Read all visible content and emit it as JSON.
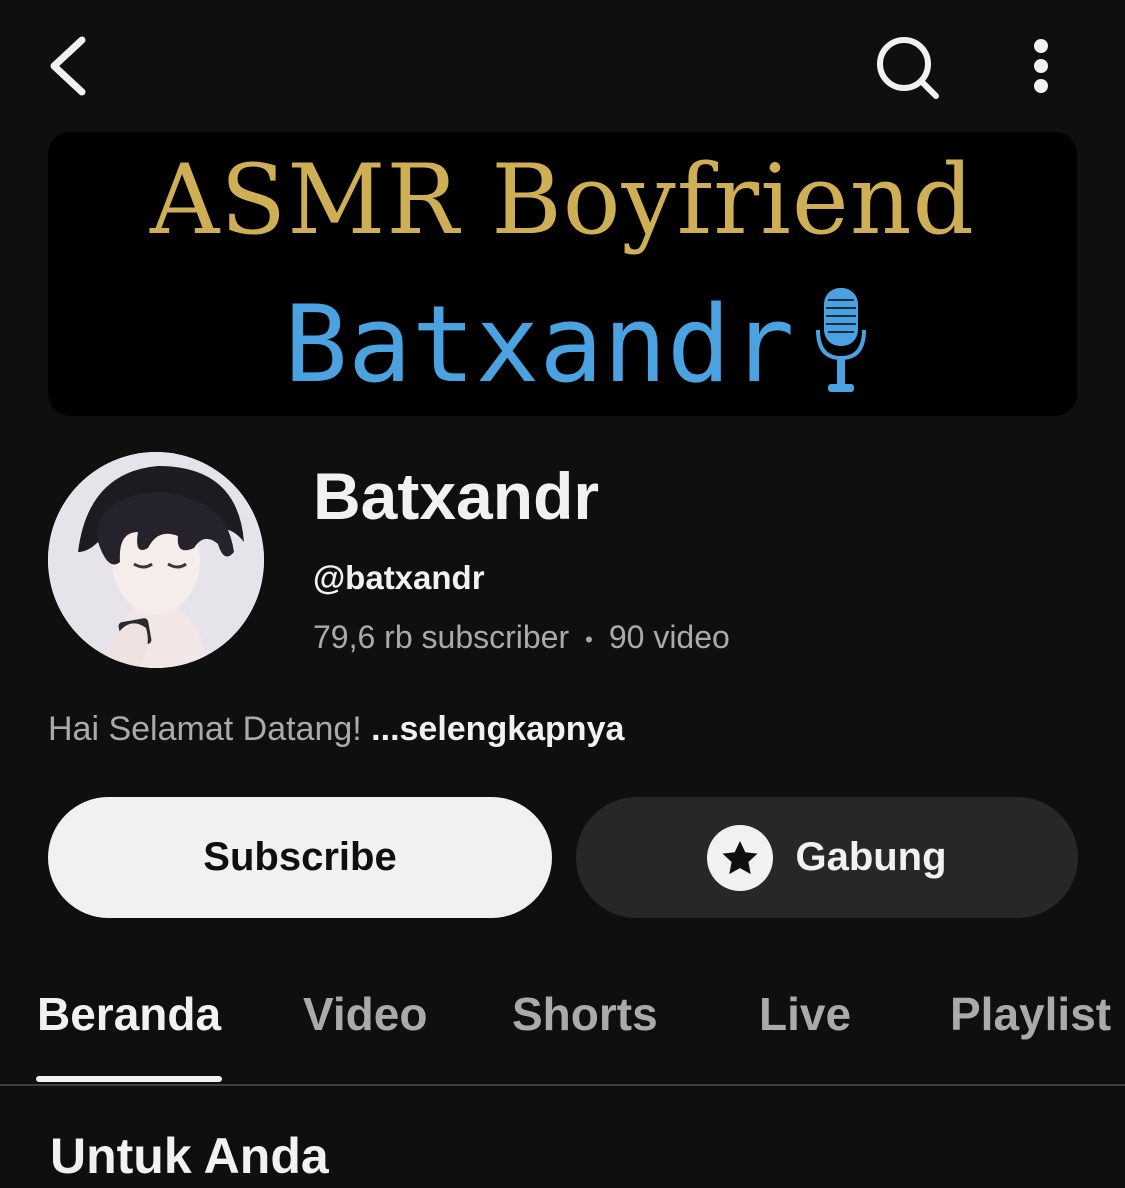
{
  "header": {
    "back_icon": "chevron-left-icon",
    "search_icon": "search-icon",
    "more_icon": "more-vertical-icon"
  },
  "banner": {
    "line1": "ASMR Boyfriend",
    "line2": "Batxandr",
    "line1_color": "#cfaf55",
    "line2_color": "#4aa3e0",
    "decoration_icon": "microphone-icon"
  },
  "channel": {
    "name": "Batxandr",
    "handle": "@batxandr",
    "subscribers": "79,6 rb subscriber",
    "separator": "•",
    "videos": "90 video",
    "description": "Hai Selamat Datang! ",
    "more_label": "...selengkapnya"
  },
  "actions": {
    "subscribe_label": "Subscribe",
    "join_label": "Gabung",
    "join_icon": "star-icon"
  },
  "tabs": [
    {
      "label": "Beranda",
      "active": true
    },
    {
      "label": "Video",
      "active": false
    },
    {
      "label": "Shorts",
      "active": false
    },
    {
      "label": "Live",
      "active": false
    },
    {
      "label": "Playlist",
      "active": false
    }
  ],
  "section": {
    "title": "Untuk Anda"
  },
  "colors": {
    "background": "#0f0f0f",
    "button_light": "#f1f1f1",
    "button_dark": "#272727",
    "text_secondary": "#aaaaaa"
  }
}
